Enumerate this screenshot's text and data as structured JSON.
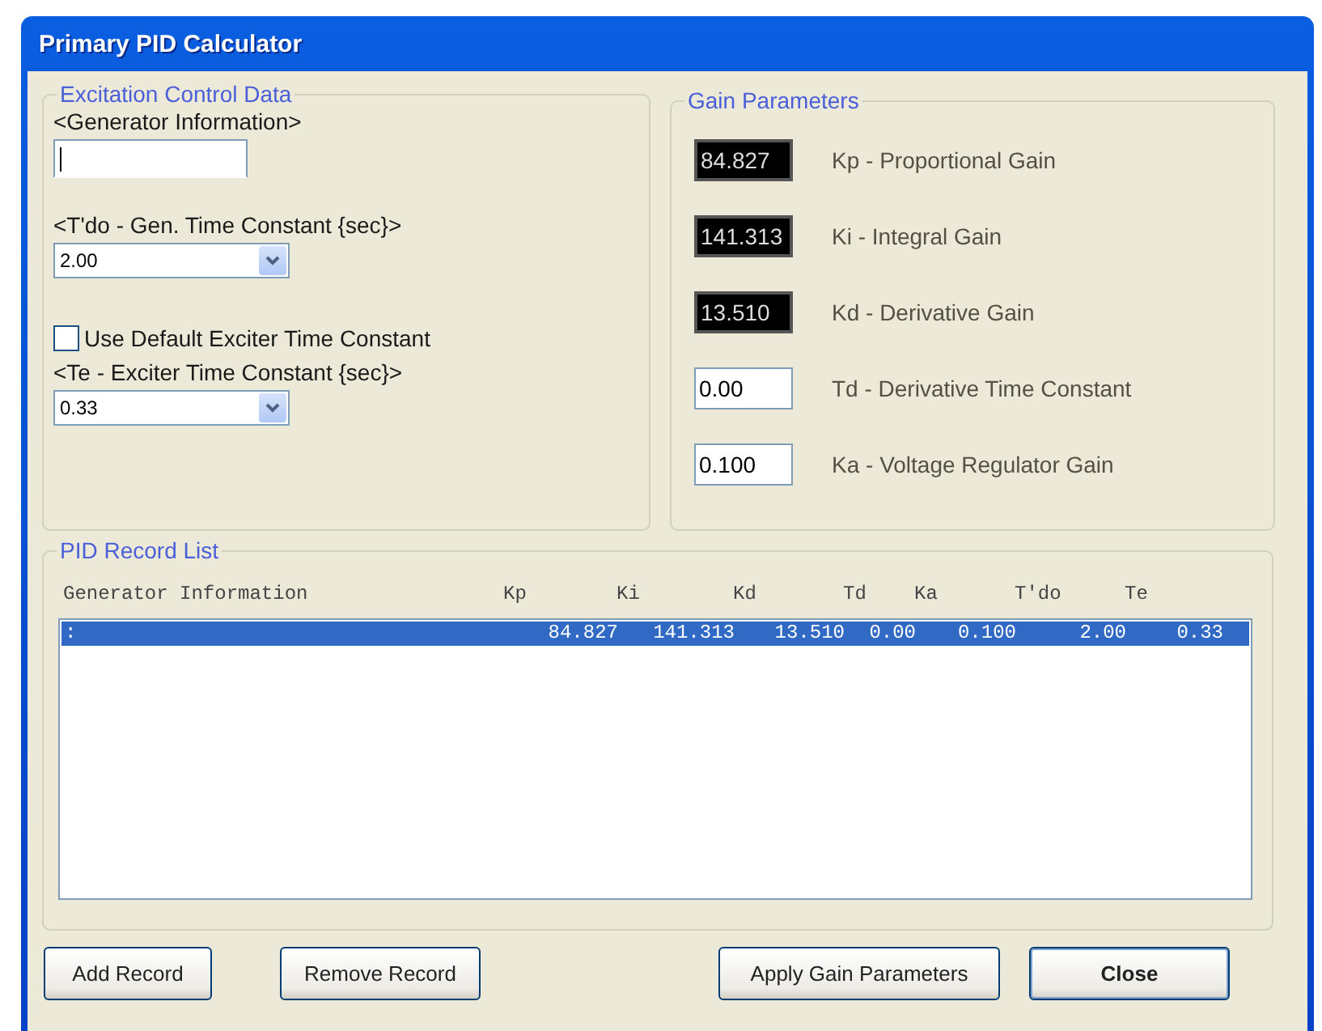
{
  "window": {
    "title": "Primary PID Calculator"
  },
  "excitation": {
    "title": "Excitation Control Data",
    "generator_label": "<Generator Information>",
    "tdo_label": "<T'do - Gen. Time Constant {sec}>",
    "tdo_value": "2.00",
    "default_exciter": {
      "label": "Use Default Exciter Time Constant",
      "checked": false
    },
    "te_label": "<Te - Exciter Time Constant {sec}>",
    "te_value": "0.33"
  },
  "gain": {
    "title": "Gain Parameters",
    "params": [
      {
        "kind": "readout",
        "value": "84.827",
        "label": "Kp - Proportional Gain"
      },
      {
        "kind": "readout",
        "value": "141.313",
        "label": "Ki - Integral Gain"
      },
      {
        "kind": "readout",
        "value": "13.510",
        "label": "Kd - Derivative Gain"
      },
      {
        "kind": "input",
        "value": "0.00",
        "label": "Td - Derivative Time Constant"
      },
      {
        "kind": "input",
        "value": "0.100",
        "label": "Ka - Voltage Regulator Gain"
      }
    ]
  },
  "records": {
    "title": "PID Record List",
    "columns": [
      "Generator Information",
      "Kp",
      "Ki",
      "Kd",
      "Td",
      "Ka",
      "T'do",
      "Te"
    ],
    "rows": [
      {
        "cells": [
          ":",
          "84.827",
          "141.313",
          "13.510",
          "0.00",
          "0.100",
          "2.00",
          "0.33"
        ],
        "selected": true
      }
    ]
  },
  "buttons": [
    {
      "label": "Add Record",
      "default": false
    },
    {
      "label": "Remove Record",
      "default": false
    },
    {
      "label": "Apply Gain Parameters",
      "default": false
    },
    {
      "label": "Close",
      "default": true
    }
  ]
}
